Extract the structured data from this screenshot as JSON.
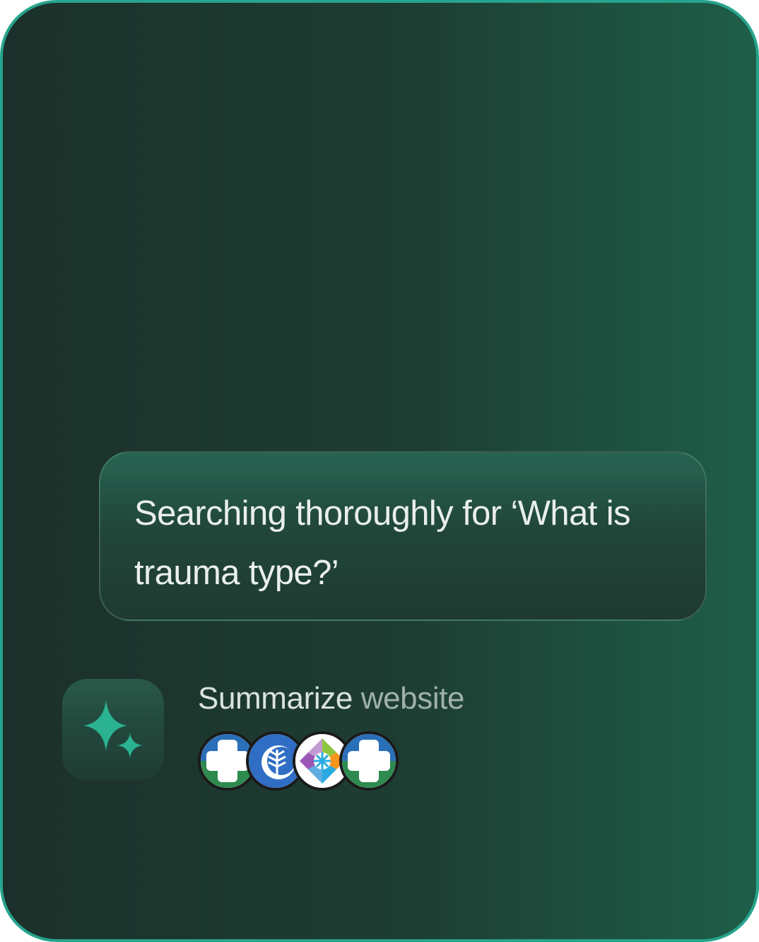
{
  "search_status": {
    "text": "Searching thoroughly for ‘What is trauma type?’"
  },
  "assistant_step": {
    "icon": "sparkle-icon",
    "action_verb": "Summarize",
    "action_object": "website"
  },
  "sources": [
    {
      "icon": "hospital-cross-logo-icon"
    },
    {
      "icon": "tree-leaf-logo-icon"
    },
    {
      "icon": "snowflake-diamond-logo-icon"
    },
    {
      "icon": "hospital-cross-logo-icon"
    }
  ],
  "colors": {
    "accent": "#27a48c",
    "sparkle": "#2bb391",
    "background_start": "#1b302a",
    "background_end": "#1e5e48",
    "text_primary": "#e9efec",
    "text_muted": "#9fb1aa"
  }
}
